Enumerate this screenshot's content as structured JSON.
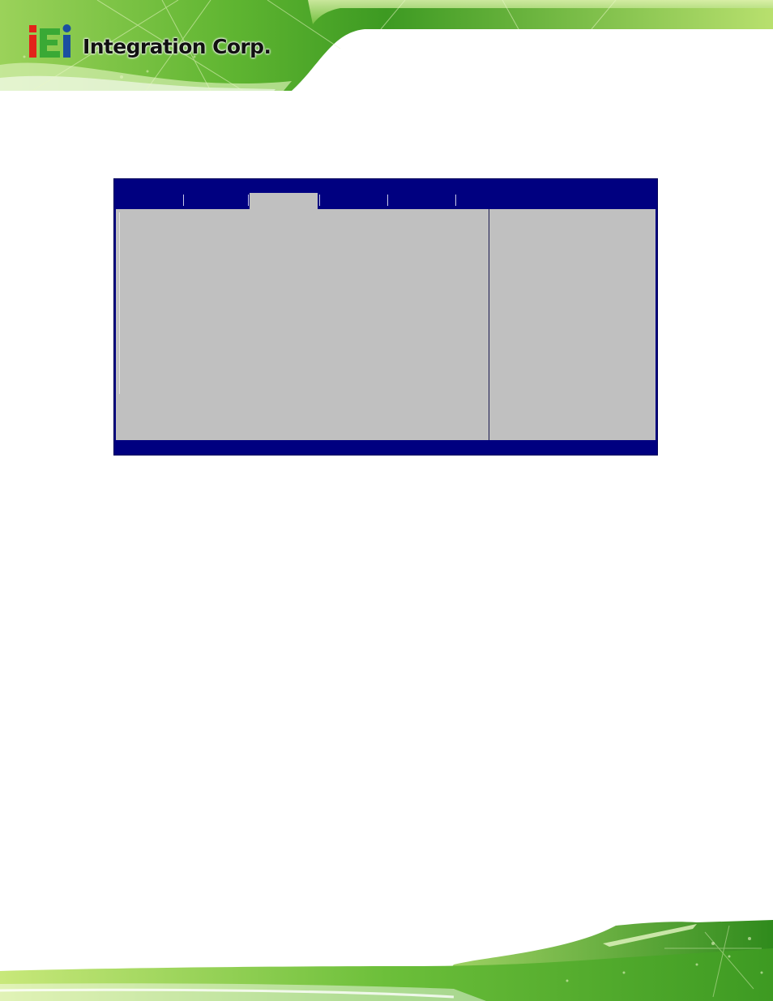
{
  "header": {
    "company_name": "Integration Corp.",
    "logo_mark": "iEi",
    "logo_icon": "iei-logo-icon",
    "colors": {
      "banner_light": "#c8e87a",
      "banner_mid": "#5fb531",
      "banner_dark": "#2f8a1c",
      "logo_red": "#e2231a",
      "logo_green": "#3aa935",
      "logo_blue": "#1b4fa0"
    }
  },
  "bios_screen": {
    "menu_tabs": [
      "",
      "",
      "",
      "",
      ""
    ],
    "active_tab_index": 2,
    "colors": {
      "background": "#000080",
      "panel": "#c0c0c0"
    }
  },
  "footer": {
    "colors": {
      "banner_light": "#c8e87a",
      "banner_dark": "#2f8a1c"
    }
  }
}
